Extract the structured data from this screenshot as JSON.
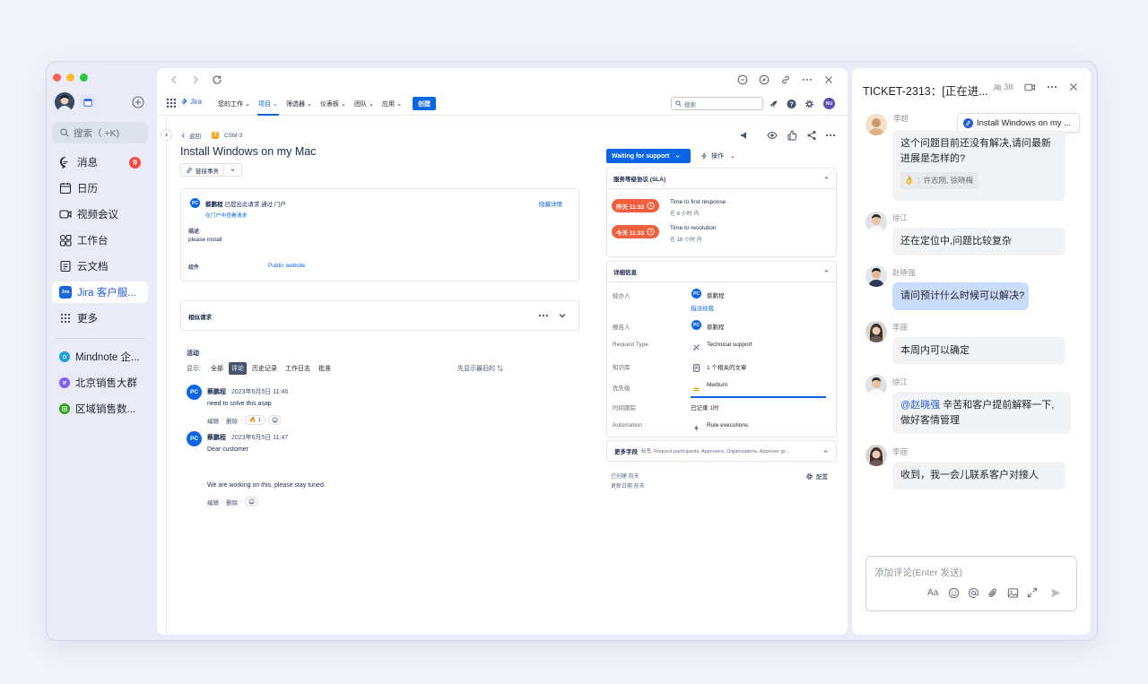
{
  "window": {
    "traffic_lights": [
      "#ff5f57",
      "#febc2e",
      "#28c840"
    ],
    "accent": "#245bdb"
  },
  "sidebar": {
    "search_placeholder": "搜索（ +K)",
    "items": [
      {
        "label": "消息",
        "icon": "chat-bubble-icon",
        "badge": "9"
      },
      {
        "label": "日历",
        "icon": "calendar-icon"
      },
      {
        "label": "视频会议",
        "icon": "video-icon"
      },
      {
        "label": "工作台",
        "icon": "workplace-grid-icon"
      },
      {
        "label": "云文档",
        "icon": "doc-icon"
      },
      {
        "label": "Jira 客户服...",
        "icon": "jira-app-icon",
        "active": true
      },
      {
        "label": "更多",
        "icon": "more-grid-icon"
      }
    ],
    "pinned": [
      {
        "label": "Mindnote 企...",
        "color": "#1e9fd8",
        "icon": "mindnote-icon"
      },
      {
        "label": "北京销售大群",
        "color": "#7b61ff",
        "icon": "group-chat-icon"
      },
      {
        "label": "区域销售数...",
        "color": "#2ea121",
        "icon": "sheet-icon"
      }
    ]
  },
  "jira": {
    "brand": "Jira",
    "nav": [
      "您的工作",
      "项目",
      "筛选器",
      "仪表板",
      "团队",
      "应用"
    ],
    "create_label": "创建",
    "search_placeholder": "搜索",
    "user_initials": "NU",
    "breadcrumb": {
      "back": "返回",
      "key": "CSM-3"
    },
    "title": "Install Windows on my Mac",
    "link_issue_label": "链接事务",
    "request": {
      "reporter": "蔡鹏程",
      "raised_text": "已提出此请求 通过 门户",
      "portal_link": "在门户中查看请求",
      "hide_label": "隐藏详情",
      "desc_label": "描述",
      "desc_value": "please install",
      "component_label": "组件",
      "component_value": "Public website"
    },
    "similar_label": "相似请求",
    "activity": {
      "title": "活动",
      "show_label": "显示:",
      "tabs": [
        "全部",
        "评论",
        "历史记录",
        "工作日志",
        "批准"
      ],
      "active_tab": "评论",
      "sort_label": "先显示最旧的",
      "comments": [
        {
          "author": "蔡鹏程",
          "time": "2023年6月5日 11:46",
          "lines": [
            "need to solve this asap"
          ],
          "actions": [
            "编辑",
            "删除"
          ],
          "reaction": "🔥 1"
        },
        {
          "author": "蔡鹏程",
          "time": "2023年6月5日 11:47",
          "lines": [
            "Dear customer",
            "We are working on this, please stay tuned."
          ],
          "actions": [
            "编辑",
            "删除"
          ]
        }
      ]
    },
    "status_label": "Waiting for support",
    "actions_label": "操作",
    "sla": {
      "title": "服务等级协议 (SLA)",
      "items": [
        {
          "badge": "昨天 11:33",
          "name": "Time to first response",
          "sub": "在 8 小时 内"
        },
        {
          "badge": "今天 11:33",
          "name": "Time to resolution",
          "sub": "在 16 小时 内"
        }
      ]
    },
    "details": {
      "title": "详细信息",
      "assignee_label": "经办人",
      "assignee": "蔡鹏程",
      "assign_me": "指派给我",
      "reporter_label": "报告人",
      "reporter": "蔡鹏程",
      "request_type_label": "Request Type",
      "request_type": "Technical support",
      "kb_label": "知识库",
      "kb_value": "1 个相关的文章",
      "priority_label": "优先级",
      "priority_value": "Medium",
      "time_label": "时间跟踪",
      "time_value": "已记录 1时",
      "time_progress": 1.0,
      "automation_label": "Automation",
      "automation_value": "Rule executions"
    },
    "more_fields": {
      "title": "更多字段",
      "sub": "标签, Request participants, Approvers, Organizations, Approver gr..."
    },
    "meta": {
      "created": "已创建 前天",
      "updated": "更新日期 前天",
      "config": "配置"
    }
  },
  "chat": {
    "title": "TICKET-2313：[正在进...",
    "member_count": "38",
    "pinned_card": "Install Windows on my ...",
    "input_placeholder": "添加评论(Enter 发送)",
    "messages": [
      {
        "name": "李超",
        "text": "这个问题目前还没有解决,请问最新进展是怎样的?",
        "reactions": "许志刚, 徐晓梅"
      },
      {
        "name": "徐江",
        "text": "还在定位中,问题比较复杂"
      },
      {
        "name": "赵晓强",
        "text": "请问预计什么时候可以解决?",
        "mine": true
      },
      {
        "name": "李丽",
        "text": "本周内可以确定"
      },
      {
        "name": "徐江",
        "mention": "@赵晓强",
        "text": " 辛苦和客户提前解释一下,做好客情管理"
      },
      {
        "name": "李丽",
        "text": "收到，我一会儿联系客户对接人"
      }
    ]
  }
}
